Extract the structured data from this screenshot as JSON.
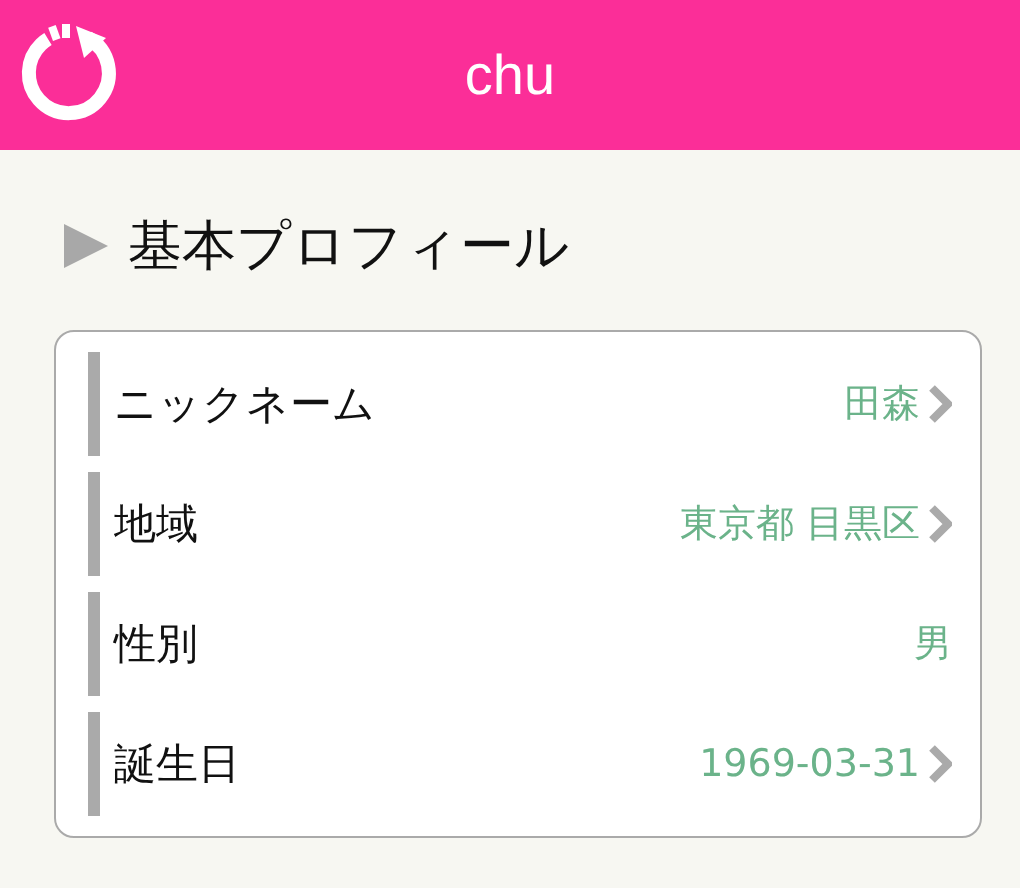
{
  "header": {
    "title": "chu"
  },
  "section": {
    "title": "基本プロフィール"
  },
  "rows": [
    {
      "label": "ニックネーム",
      "value": "田森",
      "arrow": true
    },
    {
      "label": "地域",
      "value": "東京都 目黒区",
      "arrow": true
    },
    {
      "label": "性別",
      "value": "男",
      "arrow": false
    },
    {
      "label": "誕生日",
      "value": "1969-03-31",
      "arrow": true
    }
  ]
}
